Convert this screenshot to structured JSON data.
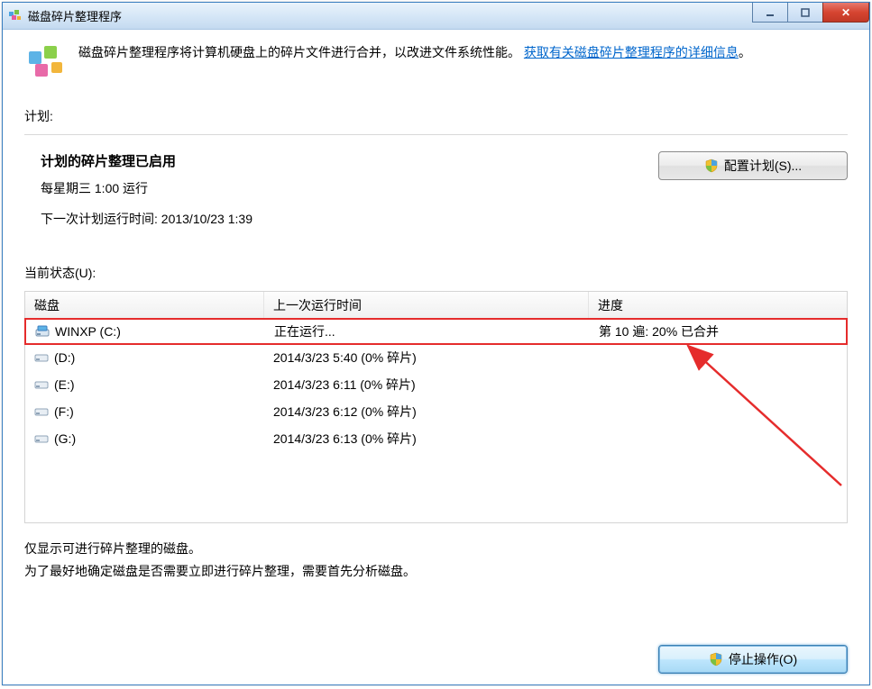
{
  "titlebar": {
    "title": "磁盘碎片整理程序"
  },
  "intro": {
    "text_before": "磁盘碎片整理程序将计算机硬盘上的碎片文件进行合并，以改进文件系统性能。",
    "link_text": "获取有关磁盘碎片整理程序的详细信息",
    "period": "。"
  },
  "schedule": {
    "label": "计划:",
    "heading": "计划的碎片整理已启用",
    "line1": "每星期三   1:00 运行",
    "line2": "下一次计划运行时间: 2013/10/23 1:39",
    "config_button": "配置计划(S)..."
  },
  "status": {
    "label": "当前状态(U):",
    "columns": {
      "disk": "磁盘",
      "last_run": "上一次运行时间",
      "progress": "进度"
    },
    "rows": [
      {
        "name": "WINXP (C:)",
        "last_run": "正在运行...",
        "progress": "第 10 遍: 20% 已合并",
        "running": true
      },
      {
        "name": "(D:)",
        "last_run": "2014/3/23 5:40 (0% 碎片)",
        "progress": "",
        "running": false
      },
      {
        "name": "(E:)",
        "last_run": "2014/3/23 6:11 (0% 碎片)",
        "progress": "",
        "running": false
      },
      {
        "name": "(F:)",
        "last_run": "2014/3/23 6:12 (0% 碎片)",
        "progress": "",
        "running": false
      },
      {
        "name": "(G:)",
        "last_run": "2014/3/23 6:13 (0% 碎片)",
        "progress": "",
        "running": false
      }
    ]
  },
  "hints": {
    "line1": "仅显示可进行碎片整理的磁盘。",
    "line2": "为了最好地确定磁盘是否需要立即进行碎片整理，需要首先分析磁盘。"
  },
  "footer": {
    "stop_button": "停止操作(O)"
  }
}
